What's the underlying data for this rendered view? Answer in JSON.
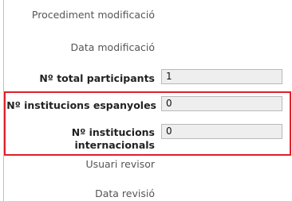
{
  "form": {
    "rows": [
      {
        "label": "Procediment modificació"
      },
      {
        "label": "Data modificació"
      },
      {
        "label": "Nº total participants",
        "value": "1"
      },
      {
        "label": "Nº institucions espanyoles",
        "value": "0"
      },
      {
        "label": "Nº institucions internacionals",
        "value": "0"
      },
      {
        "label": "Usuari revisor"
      },
      {
        "label": "Data revisió"
      }
    ]
  },
  "colors": {
    "highlight": "#e0202a",
    "field_background": "#eeeeee",
    "divider": "#b5c4d6"
  }
}
